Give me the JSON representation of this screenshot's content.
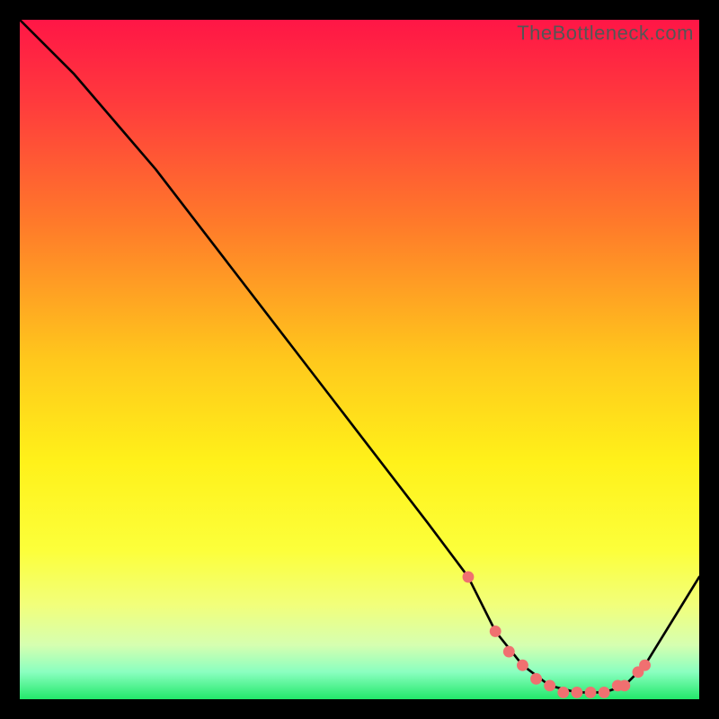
{
  "watermark": "TheBottleneck.com",
  "colors": {
    "bg": "#000000",
    "curve": "#000000",
    "marker": "#f07070",
    "gradient_stops": [
      {
        "offset": 0.0,
        "color": "#ff1646"
      },
      {
        "offset": 0.12,
        "color": "#ff3a3d"
      },
      {
        "offset": 0.3,
        "color": "#ff7a2a"
      },
      {
        "offset": 0.5,
        "color": "#ffc81c"
      },
      {
        "offset": 0.65,
        "color": "#fff11a"
      },
      {
        "offset": 0.78,
        "color": "#fcff3a"
      },
      {
        "offset": 0.86,
        "color": "#f2ff7a"
      },
      {
        "offset": 0.92,
        "color": "#d6ffb0"
      },
      {
        "offset": 0.96,
        "color": "#8affc0"
      },
      {
        "offset": 1.0,
        "color": "#22e86a"
      }
    ]
  },
  "chart_data": {
    "type": "line",
    "title": "",
    "xlabel": "",
    "ylabel": "",
    "xlim": [
      0,
      100
    ],
    "ylim": [
      0,
      100
    ],
    "series": [
      {
        "name": "curve",
        "x": [
          0,
          8,
          14,
          20,
          30,
          40,
          50,
          60,
          66,
          70,
          74,
          78,
          82,
          86,
          89,
          92,
          100
        ],
        "y": [
          100,
          92,
          85,
          78,
          65,
          52,
          39,
          26,
          18,
          10,
          5,
          2,
          1,
          1,
          2,
          5,
          18
        ]
      }
    ],
    "markers": {
      "name": "highlight-points",
      "x": [
        66,
        70,
        72,
        74,
        76,
        78,
        80,
        82,
        84,
        86,
        88,
        89,
        91,
        92
      ],
      "y": [
        18,
        10,
        7,
        5,
        3,
        2,
        1,
        1,
        1,
        1,
        2,
        2,
        4,
        5
      ]
    }
  }
}
